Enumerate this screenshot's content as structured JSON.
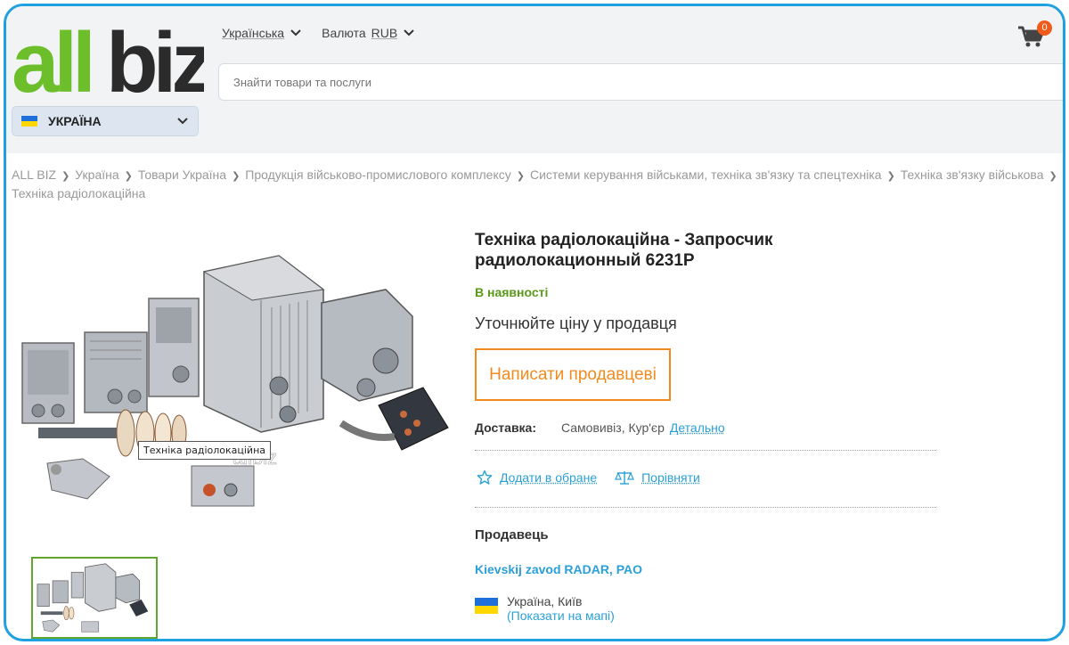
{
  "header": {
    "logo_text": "allbiz",
    "region": "УКРАЇНА",
    "language": "Українська",
    "currency_label": "Валюта",
    "currency": "RUB",
    "cart_count": "0",
    "search_placeholder": "Знайти товари та послуги"
  },
  "breadcrumb": [
    "ALL BIZ",
    "Україна",
    "Товари Україна",
    "Продукція військово-промислового комплексу",
    "Системи керування військами, техніка зв'язку та спецтехніка",
    "Техніка зв'язку військова",
    "Техніка радіолокаційна"
  ],
  "product": {
    "title": "Техніка радіолокаційна - Запросчик радиолокационный 6231Р",
    "availability": "В наявності",
    "price_text": "Уточнюйте ціну у продавця",
    "write_button": "Написати продавцеві",
    "image_tooltip": "Техніка радіолокаційна",
    "watermark": "allbiz",
    "delivery_label": "Доставка:",
    "delivery_methods": "Самовивіз,  Кур'єр",
    "delivery_link": "Детально",
    "add_favorite": "Додати в обране",
    "compare": "Порівняти"
  },
  "seller": {
    "heading": "Продавець",
    "name": "Kievskij zavod RADAR, PAO",
    "location": "Україна, Київ",
    "map_link": "(Показати на мапі)"
  },
  "colors": {
    "accent_blue": "#2aa0d8",
    "accent_orange": "#f28a1e",
    "available_green": "#5a9a1a",
    "logo_green": "#6cbf2a",
    "frame_blue": "#1fa0e0"
  }
}
